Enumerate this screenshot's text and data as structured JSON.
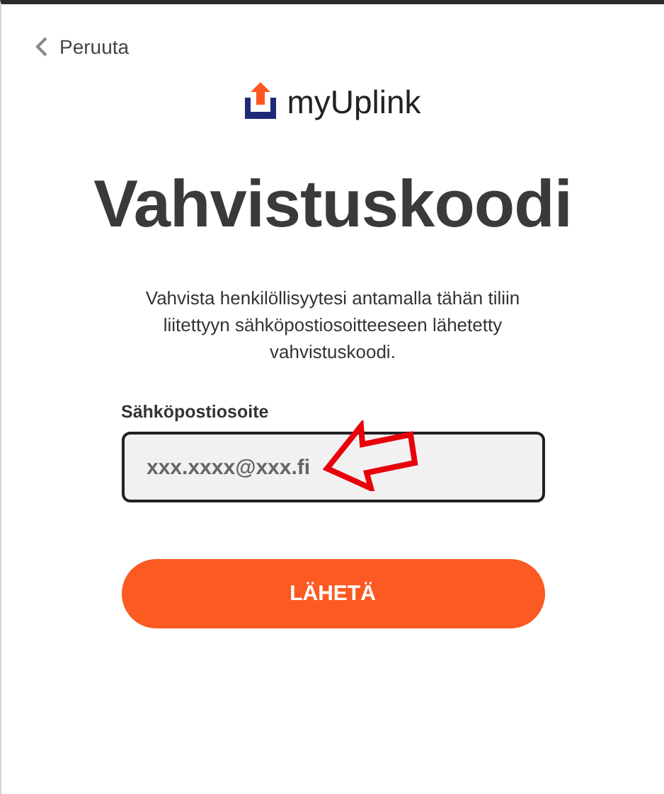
{
  "back_link": "Peruuta",
  "logo": {
    "text": "myUplink"
  },
  "title": "Vahvistuskoodi",
  "description": "Vahvista henkilöllisyytesi antamalla tähän tiliin liitettyyn sähköpostiosoitteeseen lähetetty vahvistuskoodi.",
  "email_field": {
    "label": "Sähköpostiosoite",
    "value": "xxx.xxxx@xxx.fi"
  },
  "submit_button": "LÄHETÄ"
}
